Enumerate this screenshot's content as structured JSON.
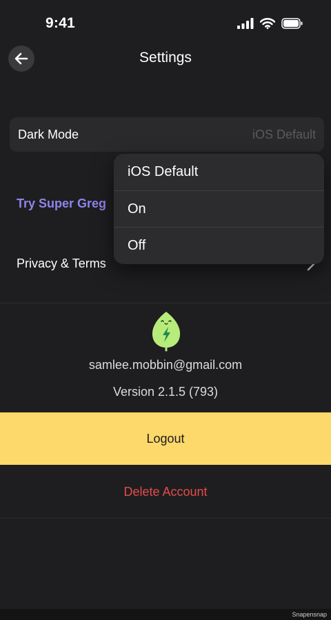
{
  "status_bar": {
    "time": "9:41"
  },
  "header": {
    "title": "Settings"
  },
  "settings": {
    "dark_mode": {
      "label": "Dark Mode",
      "value": "iOS Default"
    },
    "try_super": {
      "label": "Try Super Greg"
    },
    "privacy": {
      "label": "Privacy & Terms"
    }
  },
  "account": {
    "email": "samlee.mobbin@gmail.com",
    "version": "Version 2.1.5 (793)"
  },
  "actions": {
    "logout_label": "Logout",
    "delete_label": "Delete Account"
  },
  "dropdown": {
    "options": [
      "iOS Default",
      "On",
      "Off"
    ]
  },
  "watermark": "Snapensnap",
  "colors": {
    "background": "#1e1e20",
    "accent_purple": "#8f84ec",
    "logout_yellow": "#fdd86a",
    "delete_red": "#e54b4b",
    "leaf_green": "#b7ec7a"
  },
  "icons": {
    "back": "back-arrow-icon",
    "privacy_chevron": "chevron-right-icon",
    "logo": "leaf-mascot-icon"
  }
}
